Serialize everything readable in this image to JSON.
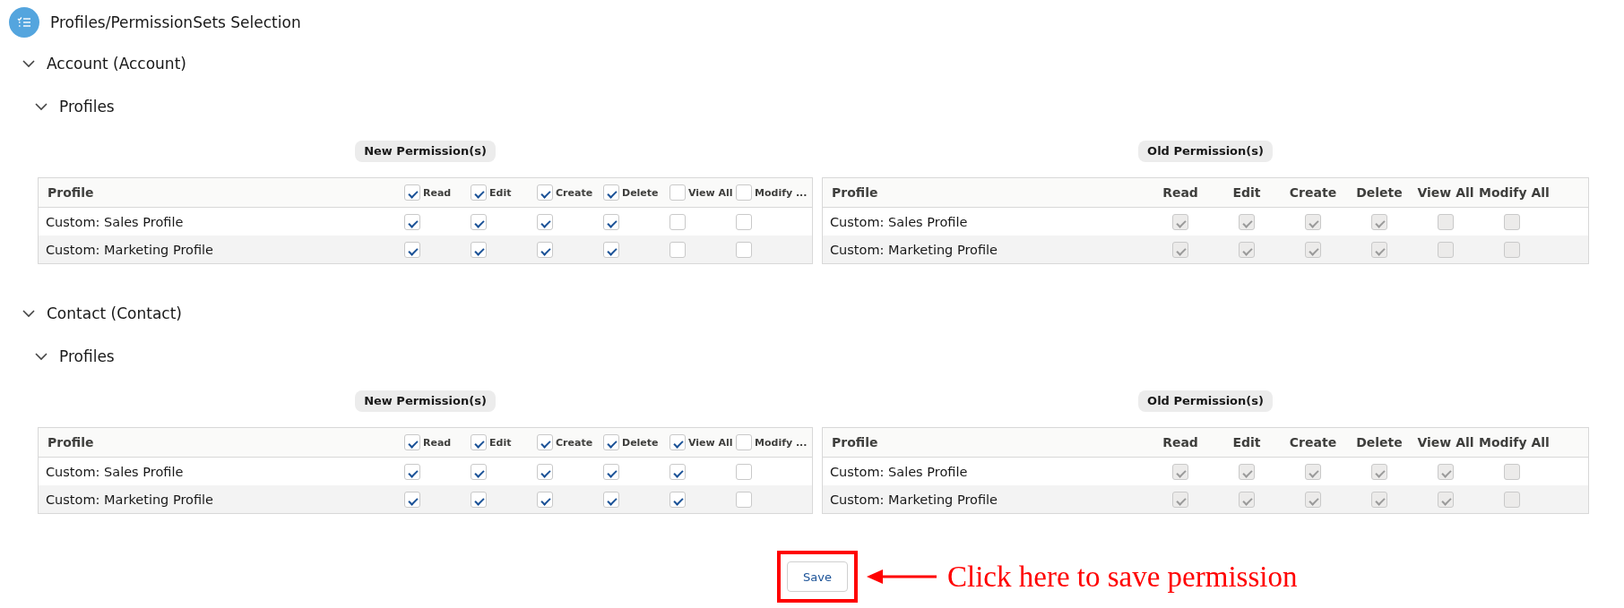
{
  "header": {
    "title": "Profiles/PermissionSets Selection"
  },
  "sections": [
    {
      "title": "Account (Account)",
      "expanded": true,
      "groups": [
        {
          "title": "Profiles",
          "expanded": true,
          "tables": [
            {
              "kind": "editable",
              "badge": "New Permission(s)",
              "first_column": "Profile",
              "columns": [
                {
                  "label": "Read",
                  "checked": true
                },
                {
                  "label": "Edit",
                  "checked": true
                },
                {
                  "label": "Create",
                  "checked": true
                },
                {
                  "label": "Delete",
                  "checked": true
                },
                {
                  "label": "View All",
                  "checked": false
                },
                {
                  "label": "Modify ...",
                  "checked": false
                }
              ],
              "rows": [
                {
                  "profile": "Custom: Sales Profile",
                  "checks": [
                    true,
                    true,
                    true,
                    true,
                    false,
                    false
                  ]
                },
                {
                  "profile": "Custom: Marketing Profile",
                  "checks": [
                    true,
                    true,
                    true,
                    true,
                    false,
                    false
                  ]
                }
              ]
            },
            {
              "kind": "readonly",
              "badge": "Old Permission(s)",
              "first_column": "Profile",
              "columns": [
                {
                  "label": "Read"
                },
                {
                  "label": "Edit"
                },
                {
                  "label": "Create"
                },
                {
                  "label": "Delete"
                },
                {
                  "label": "View All"
                },
                {
                  "label": "Modify All"
                }
              ],
              "rows": [
                {
                  "profile": "Custom: Sales Profile",
                  "checks": [
                    true,
                    true,
                    true,
                    true,
                    false,
                    false
                  ]
                },
                {
                  "profile": "Custom: Marketing Profile",
                  "checks": [
                    true,
                    true,
                    true,
                    true,
                    false,
                    false
                  ]
                }
              ]
            }
          ]
        }
      ]
    },
    {
      "title": "Contact (Contact)",
      "expanded": true,
      "groups": [
        {
          "title": "Profiles",
          "expanded": true,
          "tables": [
            {
              "kind": "editable",
              "badge": "New Permission(s)",
              "first_column": "Profile",
              "columns": [
                {
                  "label": "Read",
                  "checked": true
                },
                {
                  "label": "Edit",
                  "checked": true
                },
                {
                  "label": "Create",
                  "checked": true
                },
                {
                  "label": "Delete",
                  "checked": true
                },
                {
                  "label": "View All",
                  "checked": true
                },
                {
                  "label": "Modify ...",
                  "checked": false
                }
              ],
              "rows": [
                {
                  "profile": "Custom: Sales Profile",
                  "checks": [
                    true,
                    true,
                    true,
                    true,
                    true,
                    false
                  ]
                },
                {
                  "profile": "Custom: Marketing Profile",
                  "checks": [
                    true,
                    true,
                    true,
                    true,
                    true,
                    false
                  ]
                }
              ]
            },
            {
              "kind": "readonly",
              "badge": "Old Permission(s)",
              "first_column": "Profile",
              "columns": [
                {
                  "label": "Read"
                },
                {
                  "label": "Edit"
                },
                {
                  "label": "Create"
                },
                {
                  "label": "Delete"
                },
                {
                  "label": "View All"
                },
                {
                  "label": "Modify All"
                }
              ],
              "rows": [
                {
                  "profile": "Custom: Sales Profile",
                  "checks": [
                    true,
                    true,
                    true,
                    true,
                    true,
                    false
                  ]
                },
                {
                  "profile": "Custom: Marketing Profile",
                  "checks": [
                    true,
                    true,
                    true,
                    true,
                    true,
                    false
                  ]
                }
              ]
            }
          ]
        }
      ]
    }
  ],
  "save_button": "Save",
  "annotation": {
    "text": "Click here to save permission"
  }
}
